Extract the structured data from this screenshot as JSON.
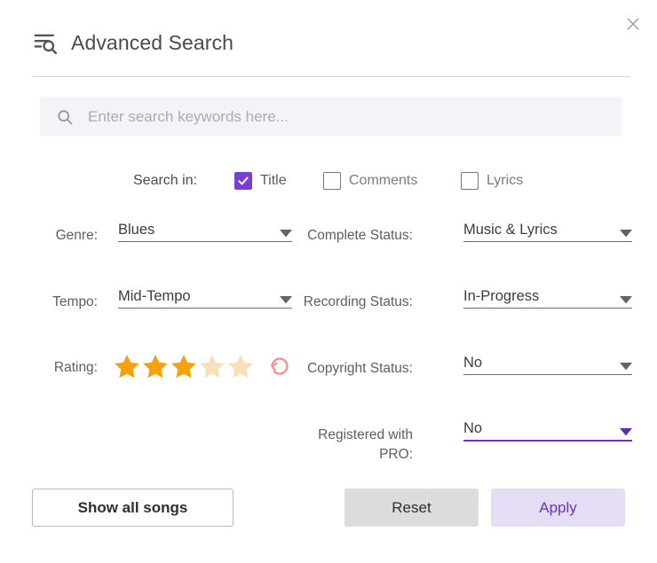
{
  "dialog": {
    "title": "Advanced Search",
    "title_icon": "filter-search-icon",
    "close_icon": "close-icon"
  },
  "search": {
    "icon": "search-icon",
    "value": "",
    "placeholder": "Enter search keywords here..."
  },
  "search_in": {
    "label": "Search in:",
    "options": [
      {
        "label": "Title",
        "checked": true
      },
      {
        "label": "Comments",
        "checked": false
      },
      {
        "label": "Lyrics",
        "checked": false
      }
    ]
  },
  "fields": {
    "genre": {
      "label": "Genre:",
      "value": "Blues",
      "focused": false
    },
    "tempo": {
      "label": "Tempo:",
      "value": "Mid-Tempo",
      "focused": false
    },
    "rating": {
      "label": "Rating:",
      "value": 3,
      "max": 5,
      "reset_icon": "reset-icon"
    },
    "complete_status": {
      "label": "Complete Status:",
      "value": "Music & Lyrics",
      "focused": false
    },
    "recording_status": {
      "label": "Recording Status:",
      "value": "In-Progress",
      "focused": false
    },
    "copyright_status": {
      "label": "Copyright Status:",
      "value": "No",
      "focused": false
    },
    "registered_with_pro": {
      "label": "Registered with PRO:",
      "value": "No",
      "focused": true
    }
  },
  "footer": {
    "show_all_label": "Show all songs",
    "reset_label": "Reset",
    "apply_label": "Apply"
  },
  "colors": {
    "accent_purple": "#6a35c0",
    "checkbox_purple": "#7a3fd0",
    "star_filled": "#f5a208",
    "star_empty": "#f7e0bb",
    "reset_pink": "#fa8d8d",
    "apply_bg": "#e5ddf3",
    "reset_bg": "#dcdcdc",
    "search_bg": "#f2f4f8"
  }
}
